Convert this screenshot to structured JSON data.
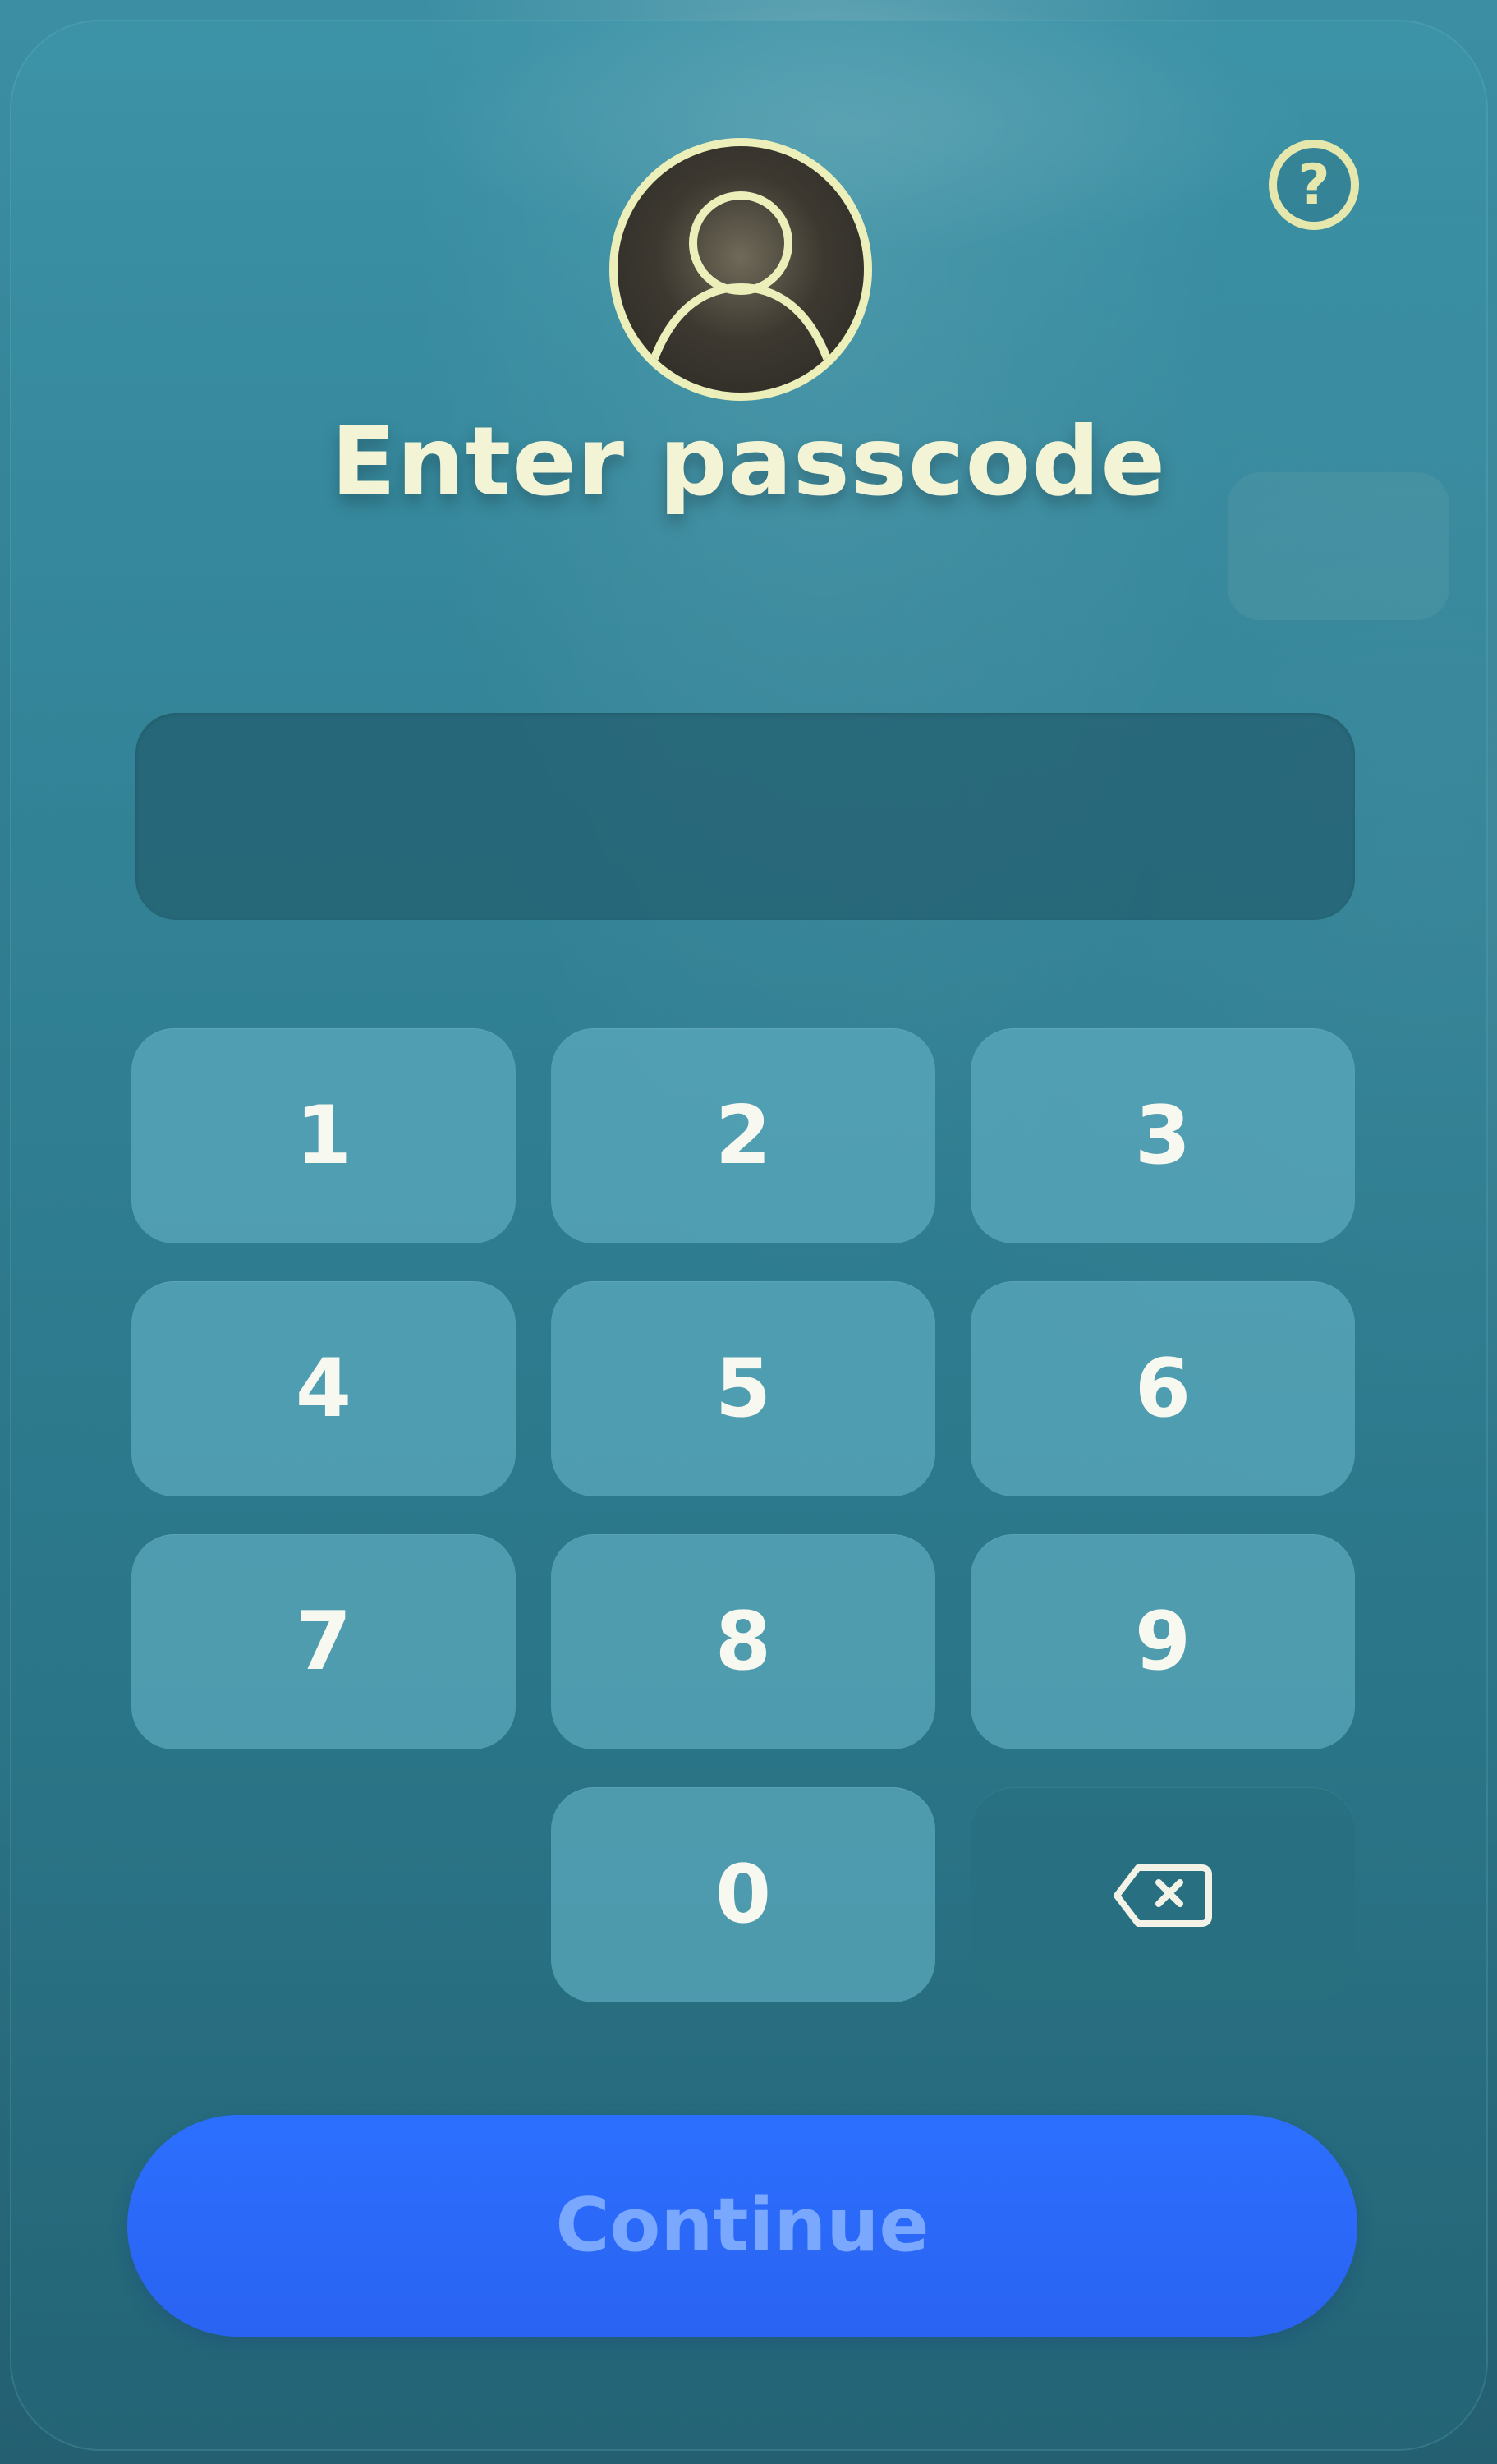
{
  "screen": {
    "title": "Enter passcode",
    "help_icon_glyph": "?",
    "avatar_icon": "user-silhouette-icon"
  },
  "passcode": {
    "value": ""
  },
  "keypad": {
    "keys": [
      "1",
      "2",
      "3",
      "4",
      "5",
      "6",
      "7",
      "8",
      "9",
      "0"
    ],
    "backspace_icon": "backspace-icon"
  },
  "actions": {
    "continue_label": "Continue"
  },
  "colors": {
    "background": "#2f7f93",
    "panel": "#3b8ea3",
    "key": "#5caabd",
    "button": "#2a66f7",
    "button_text": "#7aa8ff",
    "title_text": "#f3f4d5",
    "icon_outline": "#ecefb9"
  }
}
